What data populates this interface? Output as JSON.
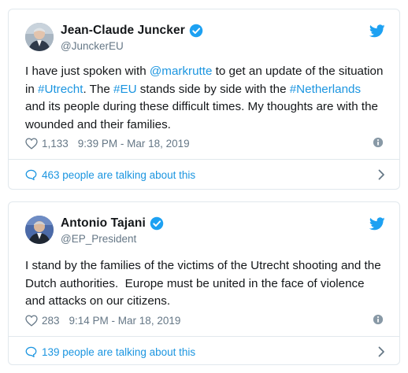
{
  "colors": {
    "link": "#1b95e0",
    "muted": "#657786",
    "border": "#e1e8ed",
    "verified": "#1da1f2"
  },
  "tweets": [
    {
      "name": "Jean-Claude Juncker",
      "handle": "@JunckerEU",
      "text_parts": [
        "I have just spoken with ",
        "@markrutte",
        " to get an update of the situation in ",
        "#Utrecht",
        ". The ",
        "#EU",
        " stands side by side with the ",
        "#Netherlands",
        " and its people during these difficult times. My thoughts are with the wounded and their families."
      ],
      "likes": "1,133",
      "timestamp": "9:39 PM - Mar 18, 2019",
      "talking": "463 people are talking about this",
      "icons": {
        "avatar": "avatar-photo",
        "verified": "verified-badge-icon",
        "brand": "twitter-bird-icon",
        "like": "heart-icon",
        "info": "info-icon",
        "reply": "speech-bubble-icon",
        "more": "chevron-right-icon"
      }
    },
    {
      "name": "Antonio Tajani",
      "handle": "@EP_President",
      "text": "I stand by the families of the victims of the Utrecht shooting and the Dutch authorities.  Europe must be united in the face of violence and attacks on our citizens.",
      "likes": "283",
      "timestamp": "9:14 PM - Mar 18, 2019",
      "talking": "139 people are talking about this",
      "icons": {
        "avatar": "avatar-photo",
        "verified": "verified-badge-icon",
        "brand": "twitter-bird-icon",
        "like": "heart-icon",
        "info": "info-icon",
        "reply": "speech-bubble-icon",
        "more": "chevron-right-icon"
      }
    }
  ]
}
